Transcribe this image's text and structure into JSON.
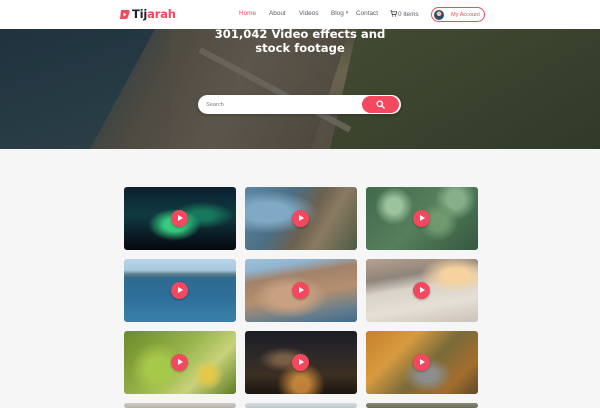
{
  "brand": {
    "name_part1": "Tij",
    "name_part2": "arah",
    "accent_color": "#f5475d"
  },
  "nav": {
    "items": [
      {
        "label": "Home",
        "active": true
      },
      {
        "label": "About",
        "active": false
      },
      {
        "label": "Videos",
        "active": false
      },
      {
        "label": "Blog",
        "active": false,
        "has_dropdown": true
      },
      {
        "label": "Contact",
        "active": false
      }
    ],
    "cart_label": "0 items",
    "cart_icon": "cart-icon",
    "account_label": "My Account"
  },
  "hero": {
    "title_line1": "301,042 Video effects and",
    "title_line2": "stock footage",
    "search_placeholder": "Search",
    "search_icon": "search-icon"
  },
  "videos": [
    {
      "subject": "aurora",
      "icon": "play-icon"
    },
    {
      "subject": "coastal-bridge",
      "icon": "play-icon"
    },
    {
      "subject": "forest-aerial",
      "icon": "play-icon"
    },
    {
      "subject": "ocean-coast",
      "icon": "play-icon"
    },
    {
      "subject": "sea-cliff",
      "icon": "play-icon"
    },
    {
      "subject": "beach-sunset",
      "icon": "play-icon"
    },
    {
      "subject": "green-plant",
      "icon": "play-icon"
    },
    {
      "subject": "city-night",
      "icon": "play-icon"
    },
    {
      "subject": "autumn-road",
      "icon": "play-icon"
    }
  ]
}
